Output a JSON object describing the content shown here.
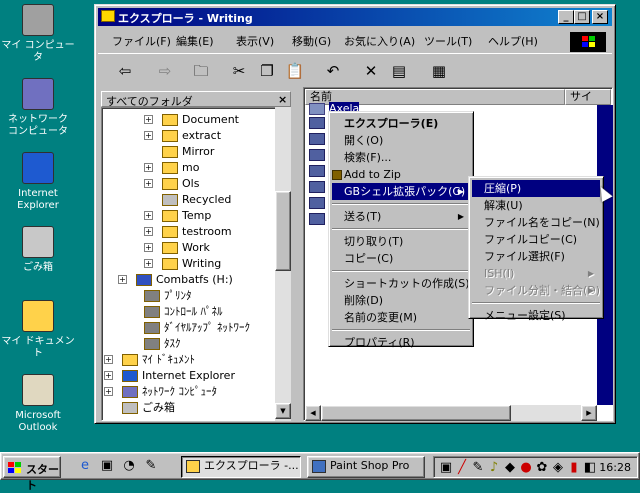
{
  "desktop": {
    "icons": [
      {
        "label": "マイ コンピュータ",
        "icon": "my-computer-icon"
      },
      {
        "label": "ネットワーク\nコンピュータ",
        "icon": "network-icon"
      },
      {
        "label": "Internet\nExplorer",
        "icon": "ie-icon"
      },
      {
        "label": "ごみ箱",
        "icon": "recycle-bin-icon"
      },
      {
        "label": "マイ ドキュメント",
        "icon": "my-documents-icon"
      },
      {
        "label": "Microsoft\nOutlook",
        "icon": "outlook-icon"
      }
    ]
  },
  "window": {
    "title": "エクスプローラ - Writing",
    "menus": [
      "ファイル(F)",
      "編集(E)",
      "表示(V)",
      "移動(G)",
      "お気に入り(A)",
      "ツール(T)",
      "ヘルプ(H)"
    ],
    "folders_header": "すべてのフォルダ",
    "close_pane": "×",
    "tree": [
      {
        "label": "Document",
        "expand": "+",
        "icon": "folder-icon"
      },
      {
        "label": "extract",
        "expand": "+",
        "icon": "folder-icon"
      },
      {
        "label": "Mirror",
        "expand": "",
        "icon": "folder-icon"
      },
      {
        "label": "mo",
        "expand": "+",
        "icon": "folder-icon"
      },
      {
        "label": "Ols",
        "expand": "+",
        "icon": "folder-icon"
      },
      {
        "label": "Recycled",
        "expand": "",
        "icon": "recycle-bin-icon"
      },
      {
        "label": "Temp",
        "expand": "+",
        "icon": "folder-icon"
      },
      {
        "label": "testroom",
        "expand": "+",
        "icon": "folder-icon"
      },
      {
        "label": "Work",
        "expand": "+",
        "icon": "folder-icon"
      },
      {
        "label": "Writing",
        "expand": "+",
        "icon": "folder-open-icon"
      },
      {
        "label": "Combatfs (H:)",
        "expand": "+",
        "icon": "drive-icon"
      },
      {
        "label": "ﾌﾟﾘﾝﾀ",
        "expand": "",
        "icon": "printer-icon"
      },
      {
        "label": "ｺﾝﾄﾛｰﾙ ﾊﾟﾈﾙ",
        "expand": "",
        "icon": "control-panel-icon"
      },
      {
        "label": "ﾀﾞｲﾔﾙｱｯﾌﾟ ﾈｯﾄﾜｰｸ",
        "expand": "",
        "icon": "dialup-icon"
      },
      {
        "label": "ﾀｽｸ",
        "expand": "",
        "icon": "tasks-icon"
      },
      {
        "label": "ﾏｲ ﾄﾞｷｭﾒﾝﾄ",
        "expand": "+",
        "icon": "my-documents-icon"
      },
      {
        "label": "Internet Explorer",
        "expand": "+",
        "icon": "ie-icon"
      },
      {
        "label": "ﾈｯﾄﾜｰｸ ｺﾝﾋﾟｭｰﾀ",
        "expand": "+",
        "icon": "network-icon"
      },
      {
        "label": "ごみ箱",
        "expand": "",
        "icon": "recycle-bin-icon"
      }
    ],
    "columns": [
      "名前",
      "サイ"
    ],
    "files": [
      {
        "label": "Axela",
        "selected": true
      }
    ]
  },
  "context_menu": {
    "items": [
      {
        "label": "エクスプローラ(E)",
        "bold": true
      },
      {
        "label": "開く(O)"
      },
      {
        "label": "検索(F)..."
      },
      {
        "label": "Add to Zip",
        "icon": "zip-icon"
      },
      {
        "label": "GBシェル拡張パック(G)",
        "highlight": true,
        "submenu": true
      },
      {
        "sep": true
      },
      {
        "label": "送る(T)",
        "submenu": true
      },
      {
        "sep": true
      },
      {
        "label": "切り取り(T)"
      },
      {
        "label": "コピー(C)"
      },
      {
        "sep": true
      },
      {
        "label": "ショートカットの作成(S)"
      },
      {
        "label": "削除(D)"
      },
      {
        "label": "名前の変更(M)"
      },
      {
        "sep": true
      },
      {
        "label": "プロパティ(R)"
      }
    ]
  },
  "submenu": {
    "items": [
      {
        "label": "圧縮(P)",
        "highlight": true
      },
      {
        "label": "解凍(U)"
      },
      {
        "label": "ファイル名をコピー(N)"
      },
      {
        "label": "ファイルコピー(C)"
      },
      {
        "label": "ファイル選択(F)"
      },
      {
        "label": "ISH(I)",
        "disabled": true,
        "submenu": true
      },
      {
        "label": "ファイル分割・結合(D)",
        "disabled": true,
        "submenu": true
      },
      {
        "sep": true
      },
      {
        "label": "メニュー設定(S)"
      }
    ]
  },
  "taskbar": {
    "start_label": "スタート",
    "tasks": [
      {
        "label": "エクスプローラ -...",
        "active": true,
        "icon": "explorer-icon"
      },
      {
        "label": "Paint Shop Pro",
        "active": false,
        "icon": "paint-shop-icon"
      }
    ],
    "clock": "16:28"
  }
}
